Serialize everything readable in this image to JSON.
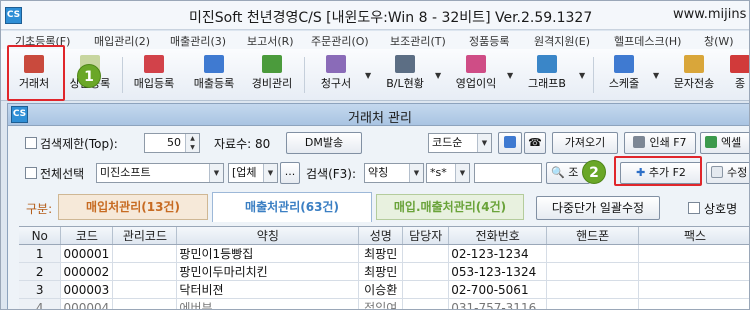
{
  "window": {
    "app_icon": "CS",
    "title": "미진Soft 천년경영C/S [내윈도우:Win 8 - 32비트] Ver.2.59.1327",
    "url_fragment": "www.mijins"
  },
  "menu": [
    "기초등록(F)",
    "매입관리(2)",
    "매출관리(3)",
    "보고서(R)",
    "주문관리(O)",
    "보조관리(T)",
    "정품등록",
    "원격지원(E)",
    "헬프데스크(H)",
    "창(W)"
  ],
  "toolbar": [
    {
      "label": "거래처",
      "icon": "vendor-card-icon",
      "color": "#c94a3d"
    },
    {
      "label": "상품등록",
      "icon": "product-icon",
      "color": "#c8d6a0"
    },
    {
      "label": "매입등록",
      "icon": "purchase-icon",
      "color": "#d2424a"
    },
    {
      "label": "매출등록",
      "icon": "sales-icon",
      "color": "#3f7ad1"
    },
    {
      "label": "경비관리",
      "icon": "expense-icon",
      "color": "#4b9b3c"
    },
    {
      "label": "청구서",
      "icon": "invoice-icon",
      "color": "#8a6bb8"
    },
    {
      "label": "B/L현황",
      "icon": "bl-icon",
      "color": "#5c6e84"
    },
    {
      "label": "영업이익",
      "icon": "profit-icon",
      "color": "#cf4d86"
    },
    {
      "label": "그래프B",
      "icon": "graph-icon",
      "color": "#3a86c8"
    },
    {
      "label": "스케줄",
      "icon": "schedule-icon",
      "color": "#3f7ad1"
    },
    {
      "label": "문자전송",
      "icon": "sms-icon",
      "color": "#d9a63a"
    },
    {
      "label": "종",
      "icon": "exit-icon",
      "color": "#d13a3a"
    }
  ],
  "annotations": {
    "marker1": "1",
    "marker2": "2"
  },
  "subwindow": {
    "app_icon": "CS",
    "title": "거래처 관리"
  },
  "controls": {
    "search_limit_label": "검색제한(Top):",
    "search_limit_value": "50",
    "record_count_label": "자료수: 80",
    "dm_button": "DM발송",
    "sort_select": "코드순",
    "import_button": "가져오기",
    "print_button": "인쇄 F7",
    "excel_button": "엑셀",
    "select_all_label": "전체선택",
    "company_field": "미진소프트",
    "type_select": "[업체",
    "ellipsis_button": "...",
    "search_label": "검색(F3):",
    "search_field_select": "약칭",
    "match_select": "*s*",
    "search_input": "",
    "search_button": "조",
    "add_button": "추가 F2",
    "edit_button": "수정"
  },
  "tabs": {
    "prefix": "구분:",
    "items": [
      {
        "label": "매입처관리(13건)",
        "color": "#c76b22"
      },
      {
        "label": "매출처관리(63건)",
        "color": "#3b7fc3"
      },
      {
        "label": "매입.매출처관리(4건)",
        "color": "#6aa33a"
      }
    ],
    "bulk_button": "다중단가 일괄수정",
    "mutual_label": "상호명"
  },
  "table": {
    "columns": [
      "No",
      "코드",
      "관리코드",
      "약칭",
      "성명",
      "담당자",
      "전화번호",
      "핸드폰",
      "팩스"
    ],
    "rows": [
      [
        "1",
        "000001",
        "",
        "팡민이1등빵집",
        "최팡민",
        "",
        "02-123-1234",
        "",
        ""
      ],
      [
        "2",
        "000002",
        "",
        "팡민이두마리치킨",
        "최팡민",
        "",
        "053-123-1324",
        "",
        ""
      ],
      [
        "3",
        "000003",
        "",
        "닥터비젼",
        "이승환",
        "",
        "02-700-5061",
        "",
        ""
      ],
      [
        "4",
        "000004",
        "",
        "에버뷰",
        "정임여",
        "",
        "031-757-3116",
        "",
        ""
      ]
    ]
  }
}
